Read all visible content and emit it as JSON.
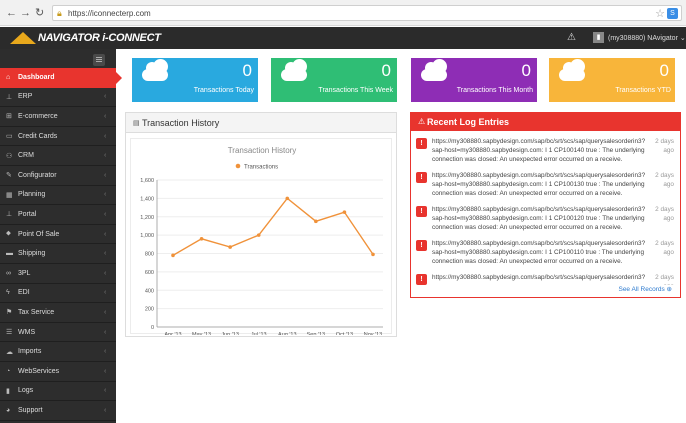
{
  "browser": {
    "url": "https://iconnecterp.com"
  },
  "app": {
    "logo": "NAVIGATOR i-CONNECT",
    "user_name": "(my308880) NAvigator"
  },
  "sidebar": {
    "items": [
      {
        "label": "Dashboard",
        "icon": "home-icon",
        "glyph": "⌂",
        "active": true
      },
      {
        "label": "ERP",
        "icon": "erp-icon",
        "glyph": "⊥"
      },
      {
        "label": "E-commerce",
        "icon": "cart-icon",
        "glyph": "⊞"
      },
      {
        "label": "Credit Cards",
        "icon": "credit-card-icon",
        "glyph": "▭"
      },
      {
        "label": "CRM",
        "icon": "users-icon",
        "glyph": "⚇"
      },
      {
        "label": "Configurator",
        "icon": "configurator-icon",
        "glyph": "✎"
      },
      {
        "label": "Planning",
        "icon": "calendar-icon",
        "glyph": "▦"
      },
      {
        "label": "Portal",
        "icon": "portal-icon",
        "glyph": "⊥"
      },
      {
        "label": "Point Of Sale",
        "icon": "tag-icon",
        "glyph": "⬥"
      },
      {
        "label": "Shipping",
        "icon": "truck-icon",
        "glyph": "▬"
      },
      {
        "label": "3PL",
        "icon": "binoculars-icon",
        "glyph": "∞"
      },
      {
        "label": "EDI",
        "icon": "bolt-icon",
        "glyph": "ϟ"
      },
      {
        "label": "Tax Service",
        "icon": "flag-icon",
        "glyph": "⚑"
      },
      {
        "label": "WMS",
        "icon": "list-icon",
        "glyph": "☰"
      },
      {
        "label": "Imports",
        "icon": "cloud-icon",
        "glyph": "☁"
      },
      {
        "label": "WebServices",
        "icon": "rss-icon",
        "glyph": "◔"
      },
      {
        "label": "Logs",
        "icon": "shield-icon",
        "glyph": "▮"
      },
      {
        "label": "Support",
        "icon": "comments-icon",
        "glyph": "◕"
      }
    ]
  },
  "cards": [
    {
      "value": "0",
      "label": "Transactions Today",
      "color": "#29a9df"
    },
    {
      "value": "0",
      "label": "Transactions This Week",
      "color": "#2fbe75"
    },
    {
      "value": "0",
      "label": "Transactions This Month",
      "color": "#8e2db5"
    },
    {
      "value": "0",
      "label": "Transactions YTD",
      "color": "#f8b53a"
    }
  ],
  "transaction_panel": {
    "title": "Transaction History"
  },
  "chart_data": {
    "type": "line",
    "title": "Transaction History",
    "categories": [
      "Apr '13",
      "May '13",
      "Jun '13",
      "Jul '13",
      "Aug '13",
      "Sep '13",
      "Oct '13",
      "Nov '13"
    ],
    "series": [
      {
        "name": "Transactions",
        "values": [
          780,
          960,
          870,
          1000,
          1400,
          1150,
          1250,
          790
        ],
        "color": "#f0923a"
      }
    ],
    "yticks": [
      "0",
      "200",
      "400",
      "600",
      "800",
      "1,000",
      "1,200",
      "1,400",
      "1,600"
    ],
    "ylim": [
      0,
      1600
    ],
    "legend": "top-center",
    "grid": true
  },
  "log_panel": {
    "title": "Recent Log Entries",
    "entries": [
      {
        "text": "https://my308880.sapbydesign.com/sap/bc/srt/scs/sap/querysalesorderin3?sap-host=my308880.sapbydesign.com: I 1 CP100140 true : The underlying connection was closed: An unexpected error occurred on a receive.",
        "time": "2 days ago"
      },
      {
        "text": "https://my308880.sapbydesign.com/sap/bc/srt/scs/sap/querysalesorderin3?sap-host=my308880.sapbydesign.com: I 1 CP100130 true : The underlying connection was closed: An unexpected error occurred on a receive.",
        "time": "2 days ago"
      },
      {
        "text": "https://my308880.sapbydesign.com/sap/bc/srt/scs/sap/querysalesorderin3?sap-host=my308880.sapbydesign.com: I 1 CP100120 true : The underlying connection was closed: An unexpected error occurred on a receive.",
        "time": "2 days ago"
      },
      {
        "text": "https://my308880.sapbydesign.com/sap/bc/srt/scs/sap/querysalesorderin3?sap-host=my308880.sapbydesign.com: I 1 CP100110 true : The underlying connection was closed: An unexpected error occurred on a receive.",
        "time": "2 days ago"
      },
      {
        "text": "https://my308880.sapbydesign.com/sap/bc/srt/scs/sap/querysalesorderin3?",
        "time": "2 days ago"
      }
    ],
    "see_all": "See All Records"
  }
}
